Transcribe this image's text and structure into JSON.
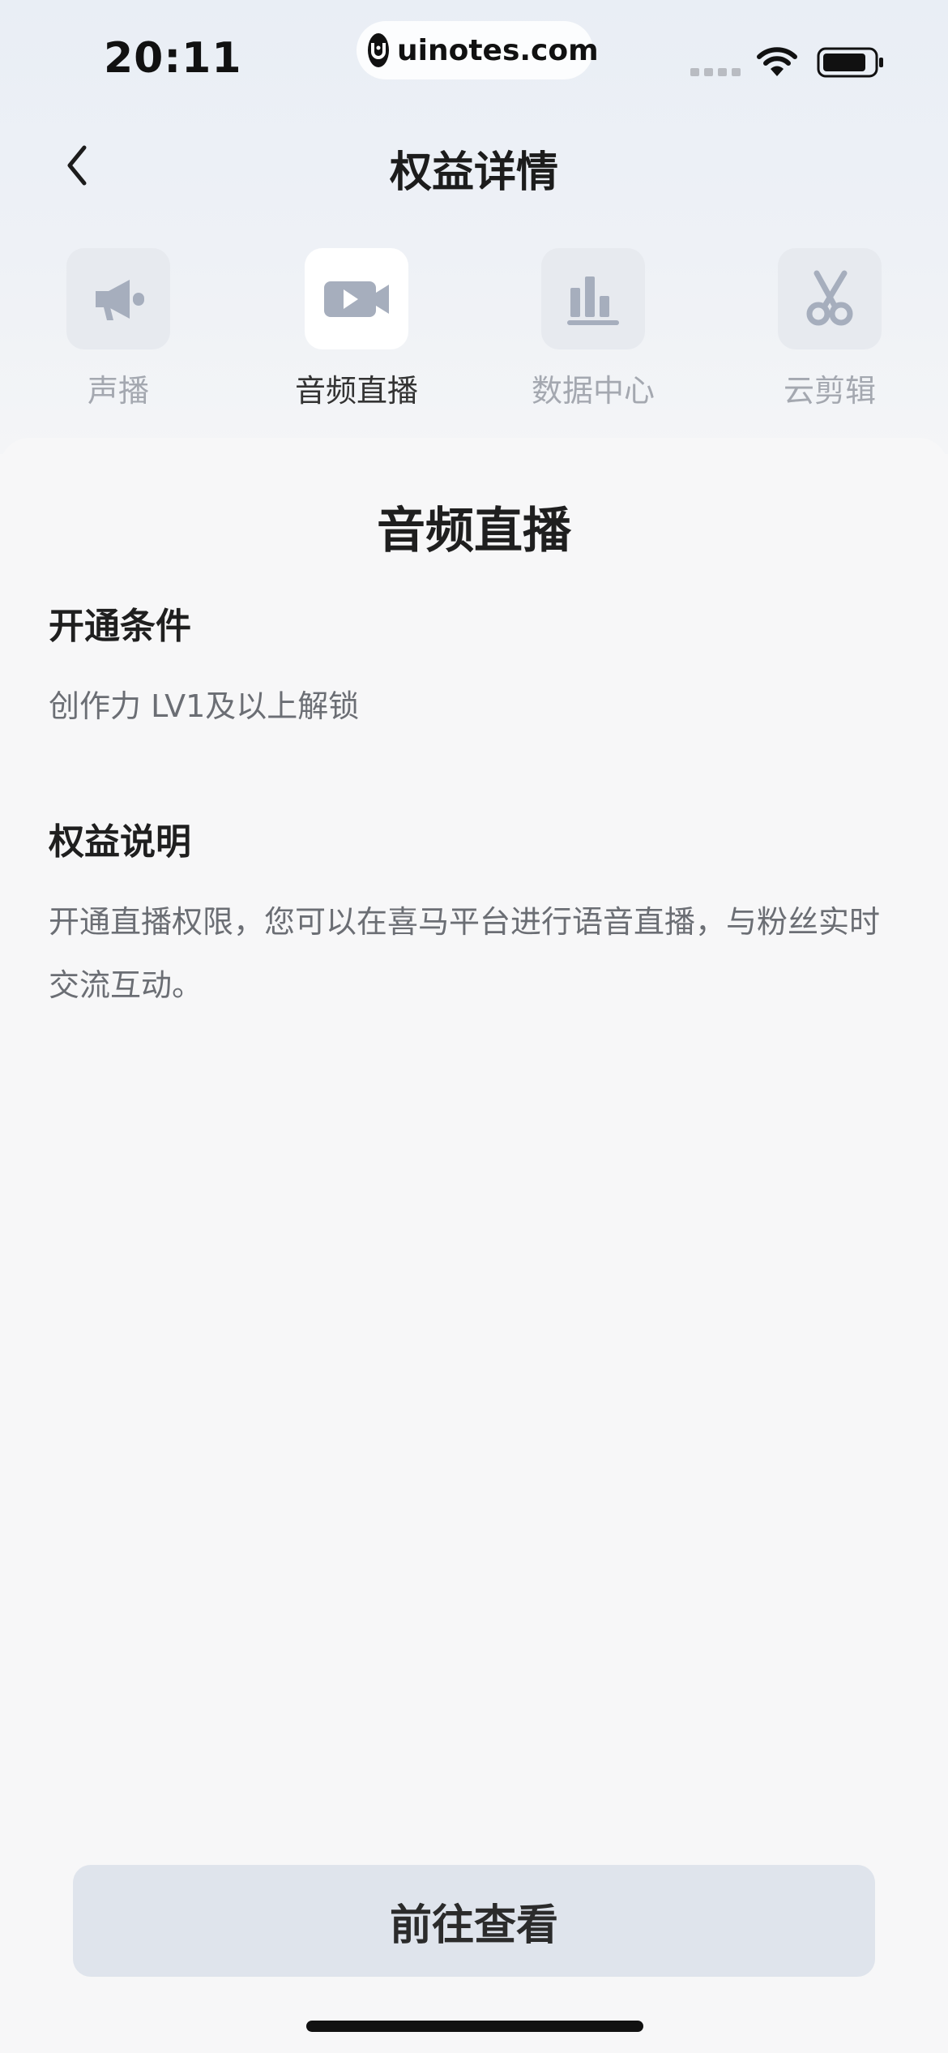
{
  "status_bar": {
    "time": "20:11",
    "url": "uinotes.com"
  },
  "nav": {
    "title": "权益详情",
    "back_icon": "chevron-left-icon"
  },
  "tabs": [
    {
      "label": "声播",
      "icon": "megaphone-icon",
      "active": false
    },
    {
      "label": "音频直播",
      "icon": "video-play-icon",
      "active": true
    },
    {
      "label": "数据中心",
      "icon": "bar-chart-icon",
      "active": false
    },
    {
      "label": "云剪辑",
      "icon": "scissors-icon",
      "active": false
    }
  ],
  "detail": {
    "title": "音频直播",
    "conditions_heading": "开通条件",
    "conditions_text": "创作力 LV1及以上解锁",
    "description_heading": "权益说明",
    "description_text": "开通直播权限，您可以在喜马平台进行语音直播，与粉丝实时交流互动。"
  },
  "cta": {
    "label": "前往查看"
  },
  "colors": {
    "icon_gray": "#a6aebd",
    "inactive_label": "#a4a8b0",
    "button_bg": "#dfe4ec"
  }
}
